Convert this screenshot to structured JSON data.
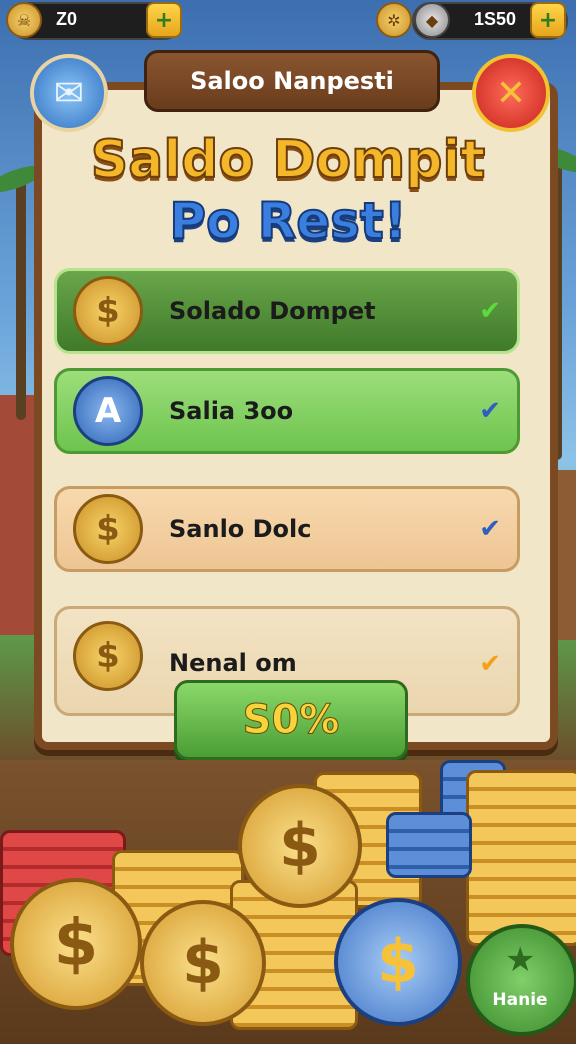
{
  "topbar": {
    "left_value": "Z0",
    "right_value": "1S50",
    "left_icon": "coin-icon",
    "mid_icon": "gear-coin-icon",
    "right_icon": "silver-coin-icon"
  },
  "dialog": {
    "plate_title": "Saloo Nanpesti",
    "heading_line1": "Saldo Dompit",
    "heading_line2": "Po Rest!",
    "items": [
      {
        "label": "Solado Dompet",
        "check": "✔",
        "theme": "dark-green"
      },
      {
        "label": "Salia 3oo",
        "check": "✔",
        "theme": "light-green"
      },
      {
        "label": "Sanlo Dolc",
        "check": "✔",
        "theme": "tan"
      },
      {
        "label": "Nenal om",
        "check": "✔",
        "theme": "beige"
      }
    ],
    "action_label": "S0%"
  },
  "bottom": {
    "corner_label": "Hanie"
  },
  "colors": {
    "panel": "#f2e6c9",
    "frame": "#7b4a22",
    "accent_gold": "#f5b72a",
    "accent_blue": "#3a7ee0",
    "button_green": "#4a9e34"
  }
}
